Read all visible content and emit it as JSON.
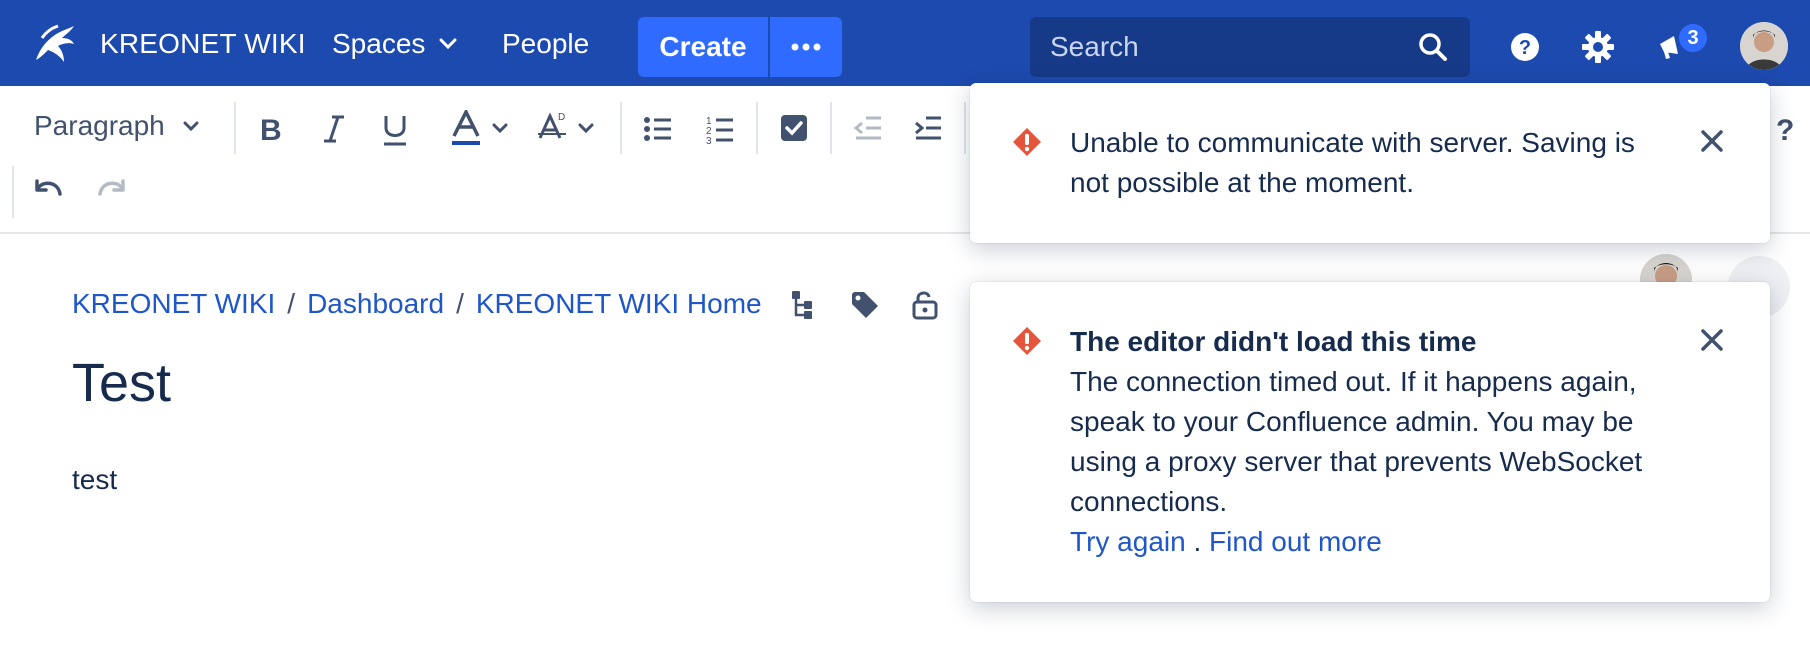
{
  "nav": {
    "brand": "KREONET WIKI",
    "spaces": "Spaces",
    "people": "People",
    "create": "Create",
    "search_placeholder": "Search",
    "notification_count": "3"
  },
  "toolbar": {
    "paragraph_style": "Paragraph",
    "help": "?"
  },
  "breadcrumb": [
    "KREONET WIKI",
    "Dashboard",
    "KREONET WIKI Home"
  ],
  "breadcrumb_separator": "/",
  "page": {
    "title": "Test",
    "body": "test"
  },
  "flags": [
    {
      "message": "Unable to communicate with server. Saving is not possible at the moment."
    },
    {
      "title": "The editor didn't load this time",
      "message": "The connection timed out. If it happens again, speak to your Confluence admin. You may be using a proxy server that prevents WebSocket connections.",
      "link1": "Try again",
      "link_sep": ".",
      "link2": "Find out more"
    }
  ],
  "colors": {
    "nav_bg": "#1d4aae",
    "accent": "#2f6bff",
    "link": "#1f56c9",
    "warning": "#e5553b",
    "text": "#172b4d"
  }
}
